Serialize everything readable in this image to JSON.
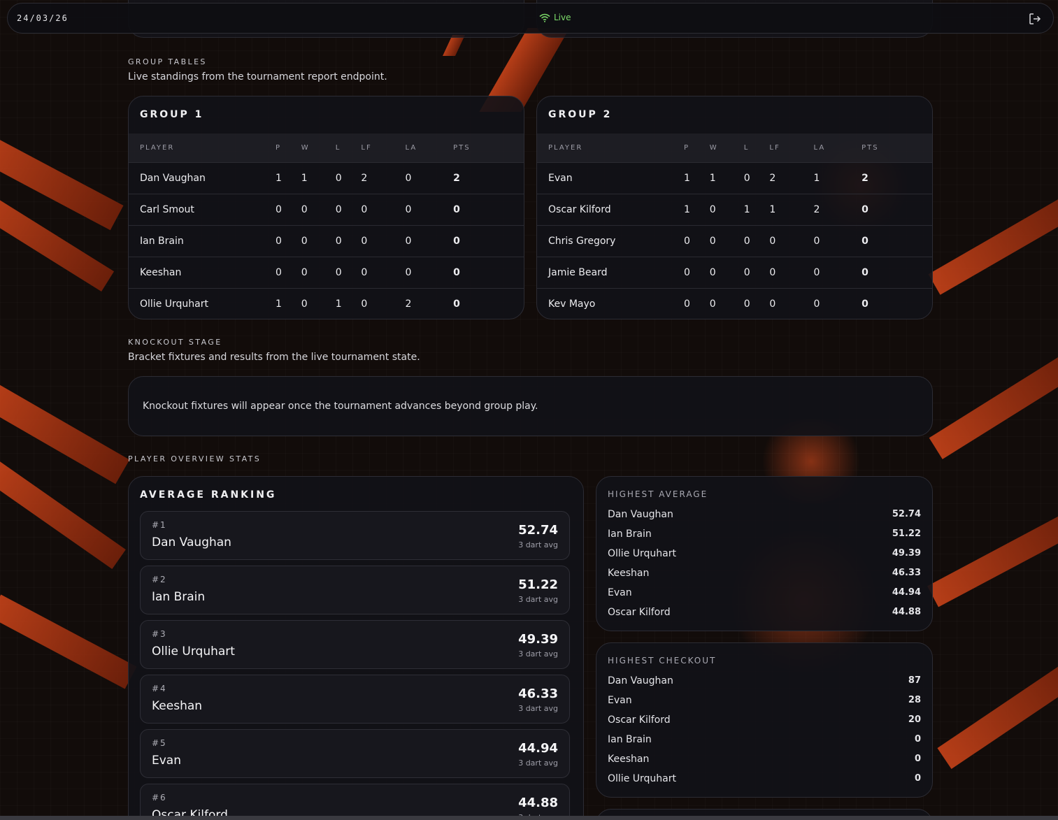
{
  "topbar": {
    "date": "24/03/26",
    "live_label": "Live",
    "live_color": "#7ddc6a"
  },
  "accent": "#d2461a",
  "groups_section": {
    "title": "GROUP TABLES",
    "subtitle": "Live standings from the tournament report endpoint."
  },
  "group_columns": [
    "PLAYER",
    "P",
    "W",
    "L",
    "LF",
    "LA",
    "PTS"
  ],
  "groups": [
    {
      "title": "GROUP 1",
      "rows": [
        [
          "Dan Vaughan",
          "1",
          "1",
          "0",
          "2",
          "0",
          "2"
        ],
        [
          "Carl Smout",
          "0",
          "0",
          "0",
          "0",
          "0",
          "0"
        ],
        [
          "Ian Brain",
          "0",
          "0",
          "0",
          "0",
          "0",
          "0"
        ],
        [
          "Keeshan",
          "0",
          "0",
          "0",
          "0",
          "0",
          "0"
        ],
        [
          "Ollie Urquhart",
          "1",
          "0",
          "1",
          "0",
          "2",
          "0"
        ]
      ]
    },
    {
      "title": "GROUP 2",
      "rows": [
        [
          "Evan",
          "1",
          "1",
          "0",
          "2",
          "1",
          "2"
        ],
        [
          "Oscar Kilford",
          "1",
          "0",
          "1",
          "1",
          "2",
          "0"
        ],
        [
          "Chris Gregory",
          "0",
          "0",
          "0",
          "0",
          "0",
          "0"
        ],
        [
          "Jamie Beard",
          "0",
          "0",
          "0",
          "0",
          "0",
          "0"
        ],
        [
          "Kev Mayo",
          "0",
          "0",
          "0",
          "0",
          "0",
          "0"
        ]
      ]
    }
  ],
  "knockout": {
    "title": "KNOCKOUT STAGE",
    "subtitle": "Bracket fixtures and results from the live tournament state.",
    "message": "Knockout fixtures will appear once the tournament advances beyond group play."
  },
  "overview": {
    "title": "PLAYER OVERVIEW STATS"
  },
  "ranking": {
    "title": "AVERAGE RANKING",
    "avg_label": "3 dart avg",
    "items": [
      {
        "rank": "#1",
        "name": "Dan Vaughan",
        "avg": "52.74"
      },
      {
        "rank": "#2",
        "name": "Ian Brain",
        "avg": "51.22"
      },
      {
        "rank": "#3",
        "name": "Ollie Urquhart",
        "avg": "49.39"
      },
      {
        "rank": "#4",
        "name": "Keeshan",
        "avg": "46.33"
      },
      {
        "rank": "#5",
        "name": "Evan",
        "avg": "44.94"
      },
      {
        "rank": "#6",
        "name": "Oscar Kilford",
        "avg": "44.88"
      }
    ]
  },
  "highest_average": {
    "title": "HIGHEST AVERAGE",
    "rows": [
      {
        "name": "Dan Vaughan",
        "value": "52.74"
      },
      {
        "name": "Ian Brain",
        "value": "51.22"
      },
      {
        "name": "Ollie Urquhart",
        "value": "49.39"
      },
      {
        "name": "Keeshan",
        "value": "46.33"
      },
      {
        "name": "Evan",
        "value": "44.94"
      },
      {
        "name": "Oscar Kilford",
        "value": "44.88"
      }
    ]
  },
  "highest_checkout": {
    "title": "HIGHEST CHECKOUT",
    "rows": [
      {
        "name": "Dan Vaughan",
        "value": "87"
      },
      {
        "name": "Evan",
        "value": "28"
      },
      {
        "name": "Oscar Kilford",
        "value": "20"
      },
      {
        "name": "Ian Brain",
        "value": "0"
      },
      {
        "name": "Keeshan",
        "value": "0"
      },
      {
        "name": "Ollie Urquhart",
        "value": "0"
      }
    ]
  }
}
